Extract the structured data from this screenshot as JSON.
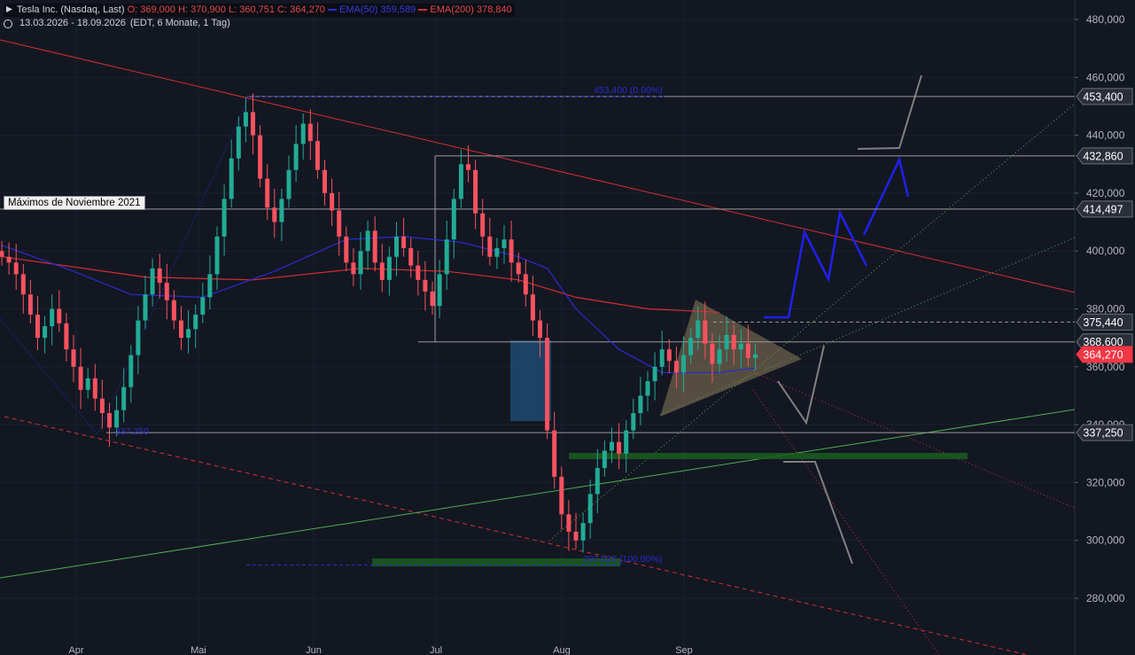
{
  "header": {
    "symbol_title": "Tesla Inc. (Nasdaq, Last)",
    "ohlc": {
      "open": "O: 369,000",
      "high": "H: 370,900",
      "low": "L: 360,751",
      "close": "C: 364,270"
    },
    "ema50_label": "EMA(50)",
    "ema50_value": "359,589",
    "ema200_label": "EMA(200)",
    "ema200_value": "378,840",
    "range_text": "13.03.2026 - 18.09.2026",
    "settings_text": "(EDT, 6 Monate, 1 Tag)"
  },
  "annotations": {
    "note_label": "Máximos de Noviembre 2021",
    "high_label": "453,400 (0.00%)",
    "low_label": "297,020 (100.00%)",
    "swing_low_label": "337,250"
  },
  "colors": {
    "background": "#131722",
    "up": "#22ab94",
    "down": "#f7525f",
    "ema50": "#2b2bd0",
    "ema200": "#d32f2f",
    "price_tag": "#f23645"
  },
  "chart_data": {
    "type": "candlestick",
    "title": "Tesla Inc. (Nasdaq, Last)",
    "x_range": [
      "2026-03-13",
      "2026-09-18"
    ],
    "ylim": [
      270000,
      485000
    ],
    "y_ticks": [
      "480,000",
      "460,000",
      "440,000",
      "420,000",
      "400,000",
      "380,000",
      "360,000",
      "340,000",
      "320,000",
      "300,000",
      "280,000"
    ],
    "x_ticks": [
      "Apr",
      "Mai",
      "Jun",
      "Jul",
      "Aug",
      "Sep"
    ],
    "price_labels": [
      {
        "text": "453,400",
        "value": 453400,
        "kind": "level"
      },
      {
        "text": "432,860",
        "value": 432860,
        "kind": "level"
      },
      {
        "text": "414,497",
        "value": 414497,
        "kind": "level"
      },
      {
        "text": "375,440",
        "value": 375440,
        "kind": "dashed"
      },
      {
        "text": "368,600",
        "value": 368600,
        "kind": "level"
      },
      {
        "text": "364,270",
        "value": 364270,
        "kind": "last"
      },
      {
        "text": "337,250",
        "value": 337250,
        "kind": "level"
      }
    ],
    "closes_approx": [
      398000,
      396000,
      392000,
      385000,
      378000,
      370000,
      374000,
      380000,
      375000,
      366000,
      360000,
      352000,
      356000,
      349000,
      344000,
      339000,
      345000,
      353000,
      364000,
      376000,
      385000,
      394000,
      389000,
      383000,
      376000,
      370000,
      373000,
      378000,
      384000,
      392000,
      405000,
      418000,
      432000,
      443000,
      448000,
      440000,
      425000,
      415000,
      410000,
      418000,
      428000,
      437000,
      444000,
      438000,
      428000,
      420000,
      414000,
      405000,
      396000,
      392000,
      400000,
      407000,
      396000,
      390000,
      398000,
      405000,
      401000,
      395000,
      390000,
      386000,
      381000,
      392000,
      404000,
      418000,
      430000,
      428000,
      413000,
      405000,
      398000,
      401000,
      404000,
      396000,
      392000,
      385000,
      376000,
      370000,
      338000,
      322000,
      309000,
      303000,
      300000,
      306000,
      316000,
      325000,
      331000,
      334000,
      330000,
      338000,
      344000,
      350000,
      355000,
      360000,
      366000,
      362000,
      358000,
      364000,
      370000,
      376000,
      368000,
      361000,
      366000,
      371000,
      366000,
      368000,
      363000,
      364270
    ],
    "ema50": [
      [
        0,
        402000
      ],
      [
        10,
        393000
      ],
      [
        18,
        385000
      ],
      [
        28,
        384000
      ],
      [
        38,
        393000
      ],
      [
        48,
        404000
      ],
      [
        56,
        405000
      ],
      [
        64,
        403000
      ],
      [
        72,
        398000
      ],
      [
        76,
        394000
      ],
      [
        80,
        380000
      ],
      [
        86,
        366000
      ],
      [
        92,
        358000
      ],
      [
        100,
        358000
      ],
      [
        105,
        359589
      ]
    ],
    "ema200": [
      [
        0,
        398000
      ],
      [
        20,
        391000
      ],
      [
        35,
        390000
      ],
      [
        50,
        394000
      ],
      [
        62,
        393000
      ],
      [
        72,
        390000
      ],
      [
        80,
        384000
      ],
      [
        90,
        380000
      ],
      [
        100,
        378840
      ]
    ],
    "legend": [
      "EMA(50)",
      "EMA(200)"
    ]
  }
}
